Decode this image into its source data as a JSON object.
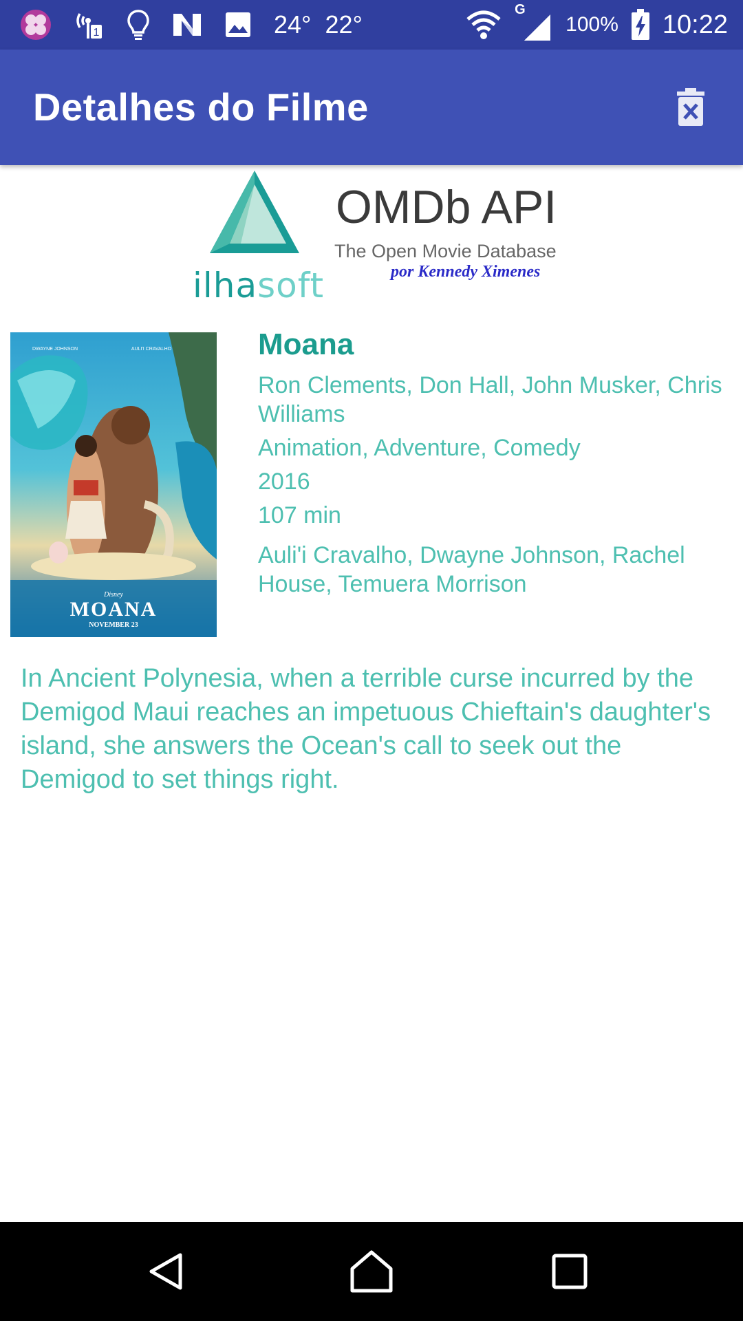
{
  "status_bar": {
    "temp1": "24°",
    "temp2": "22°",
    "network_type": "G",
    "battery": "100%",
    "time": "10:22"
  },
  "app_bar": {
    "title": "Detalhes do Filme",
    "delete_icon": "delete-icon"
  },
  "logo": {
    "api_name": "OMDb API",
    "subtitle": "The Open Movie Database",
    "author": "por Kennedy Ximenes",
    "brand_prefix": "ilha",
    "brand_suffix": "soft"
  },
  "poster": {
    "credit_left": "DWAYNE JOHNSON",
    "credit_right": "AULI'I CRAVALHO",
    "brand": "Disney",
    "title": "MOANA",
    "release": "NOVEMBER 23"
  },
  "movie": {
    "title": "Moana",
    "director": "Ron Clements, Don Hall, John Musker, Chris Williams",
    "genre": "Animation, Adventure, Comedy",
    "year": "2016",
    "runtime": "107 min",
    "actors": "Auli'i Cravalho, Dwayne Johnson, Rachel House, Temuera Morrison",
    "plot": "In Ancient Polynesia, when a terrible curse incurred by the Demigod Maui reaches an impetuous Chieftain's daughter's island, she answers the Ocean's call to seek out the Demigod to set things right."
  },
  "colors": {
    "status_bar": "#303f9f",
    "app_bar": "#3f51b5",
    "accent_text": "#4dbfb0",
    "title_text": "#1b9c8e"
  },
  "nav": {
    "back": "back-icon",
    "home": "home-icon",
    "recents": "recents-icon"
  }
}
